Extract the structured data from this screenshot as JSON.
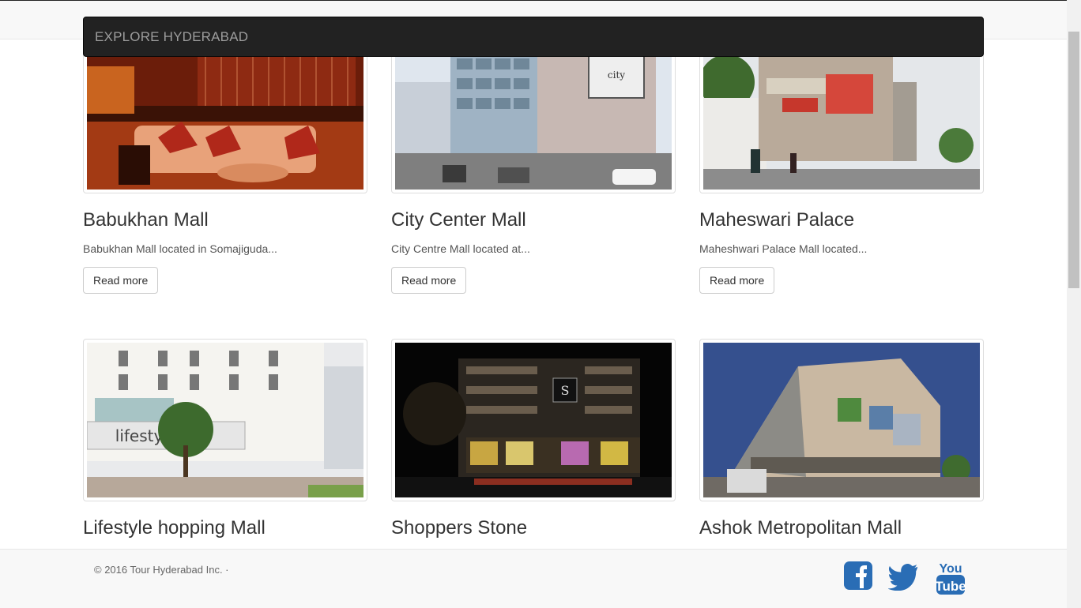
{
  "navbar": {
    "brand": "EXPLORE HYDERABAD"
  },
  "cards": [
    {
      "title": "Babukhan Mall",
      "desc": "Babukhan Mall located in Somajiguda...",
      "button": "Read more"
    },
    {
      "title": "City Center Mall",
      "desc": "City Centre Mall located at...",
      "button": "Read more"
    },
    {
      "title": "Maheswari Palace",
      "desc": "Maheshwari Palace Mall located...",
      "button": "Read more"
    },
    {
      "title": "Lifestyle hopping Mall",
      "desc": "",
      "button": ""
    },
    {
      "title": "Shoppers Stone",
      "desc": "",
      "button": ""
    },
    {
      "title": "Ashok Metropolitan Mall",
      "desc": "",
      "button": ""
    }
  ],
  "footer": {
    "copyright": "© 2016 Tour Hyderabad Inc. ·",
    "social": [
      {
        "icon": "facebook-icon",
        "color": "#2a6db5"
      },
      {
        "icon": "twitter-icon",
        "color": "#2a6db5"
      },
      {
        "icon": "youtube-icon",
        "color": "#2a6db5",
        "text1": "You",
        "text2": "Tube"
      }
    ]
  },
  "colors": {
    "navbar_bg": "#222222",
    "brand_text": "#9d9d9d",
    "social_blue": "#2a6db5"
  }
}
